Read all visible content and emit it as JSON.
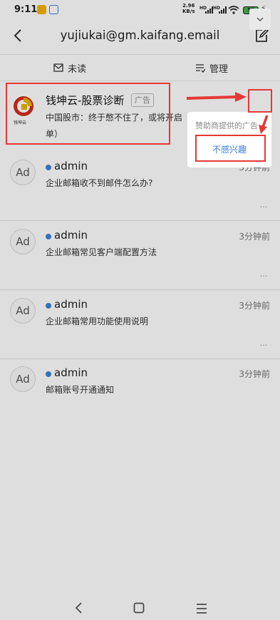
{
  "status_bar": {
    "time": "9:11",
    "net_speed_value": "2.96",
    "net_speed_unit": "KB/s",
    "signal1_label": "HD",
    "signal2_label": "HD",
    "battery_level": "57",
    "app_icons": [
      "folder-icon",
      "chat-icon"
    ]
  },
  "header": {
    "title": "yujiukai@gm.kaifang.email",
    "back_icon": "back-arrow-icon",
    "compose_icon": "compose-icon"
  },
  "filter_bar": {
    "unread_label": "未读",
    "manage_label": "管理"
  },
  "ad": {
    "logo_text": "钱坤云",
    "title": "钱坤云-股票诊断",
    "tag": "广告",
    "summary": "中国股市：终于憋不住了，或将开启",
    "summary_cont": "单）"
  },
  "popup": {
    "sponsor_text": "赞助商提供的广告",
    "not_interested_label": "不感兴趣"
  },
  "mails": [
    {
      "avatar": "Ad",
      "sender": "admin",
      "time": "3分钟前",
      "subject": "企业邮箱收不到邮件怎么办?",
      "more": "···"
    },
    {
      "avatar": "Ad",
      "sender": "admin",
      "time": "3分钟前",
      "subject": "企业邮箱常见客户端配置方法",
      "more": "···"
    },
    {
      "avatar": "Ad",
      "sender": "admin",
      "time": "3分钟前",
      "subject": "企业邮箱常用功能使用说明",
      "more": "···"
    },
    {
      "avatar": "Ad",
      "sender": "admin",
      "time": "3分钟前",
      "subject": "邮箱账号开通通知",
      "more": "···"
    }
  ],
  "colors": {
    "annotation_red": "#e53935",
    "unread_dot": "#3b82d6",
    "link_blue": "#3b7cd8",
    "battery_green": "#4caf50"
  }
}
